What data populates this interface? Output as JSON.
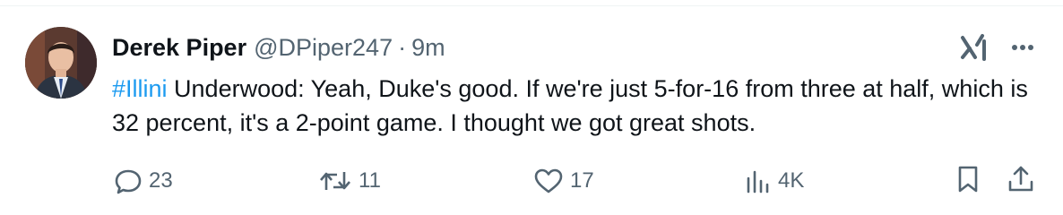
{
  "author": {
    "name": "Derek Piper",
    "handle": "@DPiper247",
    "separator": "·",
    "time": "9m"
  },
  "tweet": {
    "hashtag": "#Illini",
    "text": " Underwood: Yeah, Duke's good. If we're just 5-for-16 from three at half, which is 32 percent, it's a 2-point game. I thought we got great shots."
  },
  "actions": {
    "replies": "23",
    "retweets": "11",
    "likes": "17",
    "views": "4K"
  },
  "icons": {
    "top_right": [
      "grok-icon",
      "more-icon"
    ],
    "action_bar": [
      "reply-icon",
      "retweet-icon",
      "like-icon",
      "views-icon",
      "bookmark-icon",
      "share-icon"
    ]
  },
  "colors": {
    "text": "#0f1419",
    "secondary": "#536471",
    "hashtag": "#1d9bf0"
  }
}
